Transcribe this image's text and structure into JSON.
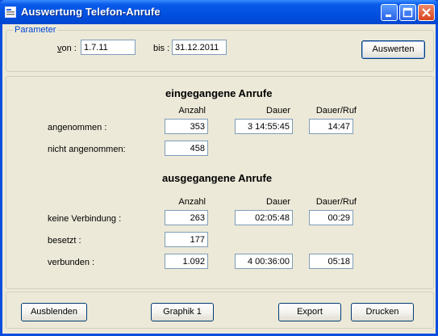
{
  "window": {
    "title": "Auswertung Telefon-Anrufe"
  },
  "parameter": {
    "legend": "Parameter",
    "von_label": "von :",
    "von_value": "1.7.11",
    "bis_label": "bis :",
    "bis_value": "31.12.2011",
    "evaluate_label": "Auswerten"
  },
  "incoming": {
    "heading": "eingegangene Anrufe",
    "col_count": "Anzahl",
    "col_duration": "Dauer",
    "col_per_call": "Dauer/Ruf",
    "rows": [
      {
        "label": "angenommen :",
        "count": "353",
        "duration": "3 14:55:45",
        "per_call": "14:47"
      },
      {
        "label": "nicht angenommen:",
        "count": "458"
      }
    ]
  },
  "outgoing": {
    "heading": "ausgegangene Anrufe",
    "col_count": "Anzahl",
    "col_duration": "Dauer",
    "col_per_call": "Dauer/Ruf",
    "rows": [
      {
        "label": "keine Verbindung :",
        "count": "263",
        "duration": "02:05:48",
        "per_call": "00:29"
      },
      {
        "label": "besetzt :",
        "count": "177"
      },
      {
        "label": "verbunden :",
        "count": "1.092",
        "duration": "4 00:36:00",
        "per_call": "05:18"
      }
    ]
  },
  "footer": {
    "hide_label": "Ausblenden",
    "graph_label": "Graphik 1",
    "export_label": "Export",
    "print_label": "Drucken"
  }
}
